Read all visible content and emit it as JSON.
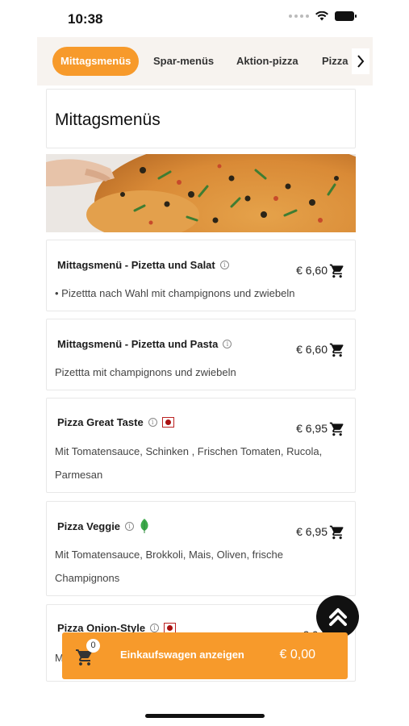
{
  "status": {
    "time": "10:38"
  },
  "tabs": [
    {
      "label": "Mittagsmenüs",
      "active": true
    },
    {
      "label": "Spar-menüs",
      "active": false
    },
    {
      "label": "Aktion-pizza",
      "active": false
    },
    {
      "label": "Pizza",
      "active": false
    }
  ],
  "section": {
    "title": "Mittagsmenüs"
  },
  "items": [
    {
      "name": "Mittagsmenü - Pizetta und Salat",
      "price": "€ 6,60",
      "description": "• Pizettta nach Wahl mit champignons und zwiebeln"
    },
    {
      "name": "Mittagsmenü - Pizetta und Pasta",
      "price": "€ 6,60",
      "description": "Pizettta mit champignons und zwiebeln"
    },
    {
      "name": "Pizza Great Taste",
      "price": "€ 6,95",
      "description": "Mit Tomatensauce, Schinken , Frischen Tomaten, Rucola, Parmesan"
    },
    {
      "name": "Pizza Veggie",
      "price": "€ 6,95",
      "description": "Mit Tomatensauce, Brokkoli, Mais, Oliven, frische Champignons"
    },
    {
      "name": "Pizza Onion-Style",
      "price": "€ 6,9",
      "description": "M"
    }
  ],
  "cart": {
    "count": "0",
    "label": "Einkaufswagen anzeigen",
    "total": "€ 0,00"
  },
  "colors": {
    "accent": "#f79a2b",
    "veggie": "#3caa4a",
    "meat": "#a11111"
  }
}
